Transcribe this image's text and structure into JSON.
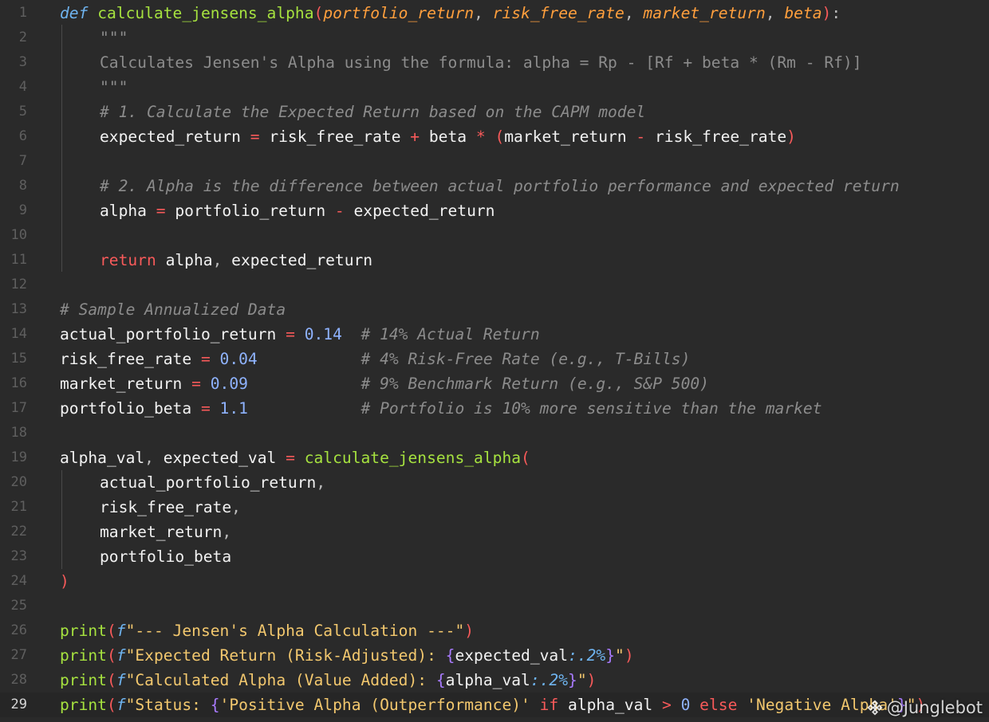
{
  "editor": {
    "current_line": 29,
    "lines": [
      {
        "n": "1",
        "indent": 0,
        "tokens": [
          {
            "t": "def",
            "c": "kwi"
          },
          {
            "t": " ",
            "c": "var"
          },
          {
            "t": "calculate_jensens_alpha",
            "c": "fn"
          },
          {
            "t": "(",
            "c": "paren"
          },
          {
            "t": "portfolio_return",
            "c": "param"
          },
          {
            "t": ", ",
            "c": "punc"
          },
          {
            "t": "risk_free_rate",
            "c": "param"
          },
          {
            "t": ", ",
            "c": "punc"
          },
          {
            "t": "market_return",
            "c": "param"
          },
          {
            "t": ", ",
            "c": "punc"
          },
          {
            "t": "beta",
            "c": "param"
          },
          {
            "t": ")",
            "c": "paren"
          },
          {
            "t": ":",
            "c": "punc"
          }
        ]
      },
      {
        "n": "2",
        "indent": 1,
        "tokens": [
          {
            "t": "\"\"\"",
            "c": "doc"
          }
        ]
      },
      {
        "n": "3",
        "indent": 1,
        "tokens": [
          {
            "t": "Calculates Jensen's Alpha using the formula: alpha = Rp - [Rf + beta * (Rm - Rf)]",
            "c": "doc"
          }
        ]
      },
      {
        "n": "4",
        "indent": 1,
        "tokens": [
          {
            "t": "\"\"\"",
            "c": "doc"
          }
        ]
      },
      {
        "n": "5",
        "indent": 1,
        "tokens": [
          {
            "t": "# 1. Calculate the Expected Return based on the CAPM model",
            "c": "cmt"
          }
        ]
      },
      {
        "n": "6",
        "indent": 1,
        "tokens": [
          {
            "t": "expected_return",
            "c": "var"
          },
          {
            "t": " = ",
            "c": "op"
          },
          {
            "t": "risk_free_rate",
            "c": "var"
          },
          {
            "t": " + ",
            "c": "op"
          },
          {
            "t": "beta",
            "c": "var"
          },
          {
            "t": " * ",
            "c": "op"
          },
          {
            "t": "(",
            "c": "paren"
          },
          {
            "t": "market_return",
            "c": "var"
          },
          {
            "t": " - ",
            "c": "op"
          },
          {
            "t": "risk_free_rate",
            "c": "var"
          },
          {
            "t": ")",
            "c": "paren"
          }
        ]
      },
      {
        "n": "7",
        "indent": 1,
        "tokens": []
      },
      {
        "n": "8",
        "indent": 1,
        "tokens": [
          {
            "t": "# 2. Alpha is the difference between actual portfolio performance and expected return",
            "c": "cmt"
          }
        ]
      },
      {
        "n": "9",
        "indent": 1,
        "tokens": [
          {
            "t": "alpha",
            "c": "var"
          },
          {
            "t": " = ",
            "c": "op"
          },
          {
            "t": "portfolio_return",
            "c": "var"
          },
          {
            "t": " - ",
            "c": "op"
          },
          {
            "t": "expected_return",
            "c": "var"
          }
        ]
      },
      {
        "n": "10",
        "indent": 1,
        "tokens": []
      },
      {
        "n": "11",
        "indent": 1,
        "tokens": [
          {
            "t": "return",
            "c": "kw"
          },
          {
            "t": " ",
            "c": "var"
          },
          {
            "t": "alpha",
            "c": "var"
          },
          {
            "t": ", ",
            "c": "punc"
          },
          {
            "t": "expected_return",
            "c": "var"
          }
        ]
      },
      {
        "n": "12",
        "indent": 0,
        "tokens": []
      },
      {
        "n": "13",
        "indent": 0,
        "tokens": [
          {
            "t": "# Sample Annualized Data",
            "c": "cmt"
          }
        ]
      },
      {
        "n": "14",
        "indent": 0,
        "tokens": [
          {
            "t": "actual_portfolio_return",
            "c": "var"
          },
          {
            "t": " = ",
            "c": "op"
          },
          {
            "t": "0.14",
            "c": "num"
          },
          {
            "t": "  ",
            "c": "var"
          },
          {
            "t": "# 14% Actual Return",
            "c": "cmt"
          }
        ]
      },
      {
        "n": "15",
        "indent": 0,
        "tokens": [
          {
            "t": "risk_free_rate",
            "c": "var"
          },
          {
            "t": " = ",
            "c": "op"
          },
          {
            "t": "0.04",
            "c": "num"
          },
          {
            "t": "           ",
            "c": "var"
          },
          {
            "t": "# 4% Risk-Free Rate (e.g., T-Bills)",
            "c": "cmt"
          }
        ]
      },
      {
        "n": "16",
        "indent": 0,
        "tokens": [
          {
            "t": "market_return",
            "c": "var"
          },
          {
            "t": " = ",
            "c": "op"
          },
          {
            "t": "0.09",
            "c": "num"
          },
          {
            "t": "            ",
            "c": "var"
          },
          {
            "t": "# 9% Benchmark Return (e.g., S&P 500)",
            "c": "cmt"
          }
        ]
      },
      {
        "n": "17",
        "indent": 0,
        "tokens": [
          {
            "t": "portfolio_beta",
            "c": "var"
          },
          {
            "t": " = ",
            "c": "op"
          },
          {
            "t": "1.1",
            "c": "num"
          },
          {
            "t": "            ",
            "c": "var"
          },
          {
            "t": "# Portfolio is 10% more sensitive than the market",
            "c": "cmt"
          }
        ]
      },
      {
        "n": "18",
        "indent": 0,
        "tokens": []
      },
      {
        "n": "19",
        "indent": 0,
        "tokens": [
          {
            "t": "alpha_val",
            "c": "var"
          },
          {
            "t": ", ",
            "c": "punc"
          },
          {
            "t": "expected_val",
            "c": "var"
          },
          {
            "t": " = ",
            "c": "op"
          },
          {
            "t": "calculate_jensens_alpha",
            "c": "fn"
          },
          {
            "t": "(",
            "c": "paren"
          }
        ]
      },
      {
        "n": "20",
        "indent": 1,
        "tokens": [
          {
            "t": "actual_portfolio_return",
            "c": "var"
          },
          {
            "t": ",",
            "c": "punc"
          }
        ]
      },
      {
        "n": "21",
        "indent": 1,
        "tokens": [
          {
            "t": "risk_free_rate",
            "c": "var"
          },
          {
            "t": ",",
            "c": "punc"
          }
        ]
      },
      {
        "n": "22",
        "indent": 1,
        "tokens": [
          {
            "t": "market_return",
            "c": "var"
          },
          {
            "t": ",",
            "c": "punc"
          }
        ]
      },
      {
        "n": "23",
        "indent": 1,
        "tokens": [
          {
            "t": "portfolio_beta",
            "c": "var"
          }
        ]
      },
      {
        "n": "24",
        "indent": 0,
        "tokens": [
          {
            "t": ")",
            "c": "paren"
          }
        ]
      },
      {
        "n": "25",
        "indent": 0,
        "tokens": []
      },
      {
        "n": "26",
        "indent": 0,
        "tokens": [
          {
            "t": "print",
            "c": "fn"
          },
          {
            "t": "(",
            "c": "paren"
          },
          {
            "t": "f",
            "c": "kwi"
          },
          {
            "t": "\"--- Jensen's Alpha Calculation ---\"",
            "c": "str"
          },
          {
            "t": ")",
            "c": "paren"
          }
        ]
      },
      {
        "n": "27",
        "indent": 0,
        "tokens": [
          {
            "t": "print",
            "c": "fn"
          },
          {
            "t": "(",
            "c": "paren"
          },
          {
            "t": "f",
            "c": "kwi"
          },
          {
            "t": "\"Expected Return (Risk-Adjusted): ",
            "c": "str"
          },
          {
            "t": "{",
            "c": "brace"
          },
          {
            "t": "expected_val",
            "c": "var"
          },
          {
            "t": ":.2%",
            "c": "fmt"
          },
          {
            "t": "}",
            "c": "brace"
          },
          {
            "t": "\"",
            "c": "str"
          },
          {
            "t": ")",
            "c": "paren"
          }
        ]
      },
      {
        "n": "28",
        "indent": 0,
        "tokens": [
          {
            "t": "print",
            "c": "fn"
          },
          {
            "t": "(",
            "c": "paren"
          },
          {
            "t": "f",
            "c": "kwi"
          },
          {
            "t": "\"Calculated Alpha (Value Added): ",
            "c": "str"
          },
          {
            "t": "{",
            "c": "brace"
          },
          {
            "t": "alpha_val",
            "c": "var"
          },
          {
            "t": ":.2%",
            "c": "fmt"
          },
          {
            "t": "}",
            "c": "brace"
          },
          {
            "t": "\"",
            "c": "str"
          },
          {
            "t": ")",
            "c": "paren"
          }
        ]
      },
      {
        "n": "29",
        "indent": 0,
        "tokens": [
          {
            "t": "print",
            "c": "fn"
          },
          {
            "t": "(",
            "c": "paren"
          },
          {
            "t": "f",
            "c": "kwi"
          },
          {
            "t": "\"Status: ",
            "c": "str"
          },
          {
            "t": "{",
            "c": "brace"
          },
          {
            "t": "'Positive Alpha (Outperformance)'",
            "c": "str"
          },
          {
            "t": " if ",
            "c": "kw"
          },
          {
            "t": "alpha_val",
            "c": "var"
          },
          {
            "t": " > ",
            "c": "op"
          },
          {
            "t": "0",
            "c": "num"
          },
          {
            "t": " else ",
            "c": "kw"
          },
          {
            "t": "'Negative Alpha'",
            "c": "str"
          },
          {
            "t": "}",
            "c": "brace"
          },
          {
            "t": "\"",
            "c": "str"
          },
          {
            "t": ")",
            "c": "paren"
          }
        ]
      }
    ]
  },
  "watermark": {
    "text": "@Junglebot",
    "icon": "exchange-diamond-icon"
  },
  "colors": {
    "background": "#2a2a2a",
    "keyword": "#f85a5a",
    "function": "#a6e23f",
    "parameter": "#ff9f3d",
    "string": "#f3c86e",
    "number": "#8fb3ff",
    "comment": "#8c8c8c"
  }
}
